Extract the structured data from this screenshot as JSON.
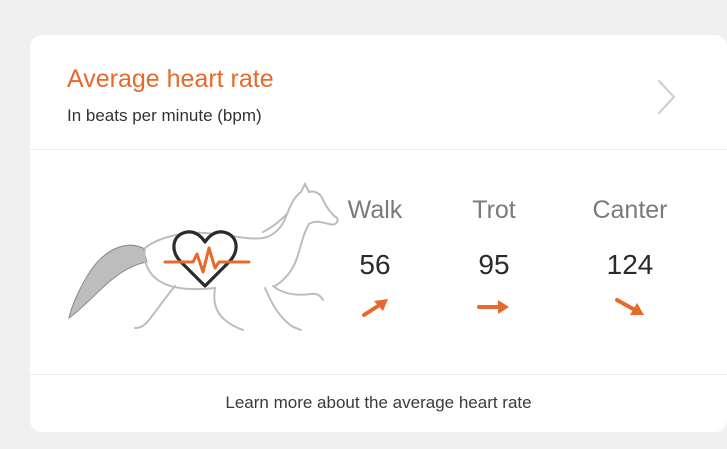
{
  "card": {
    "title": "Average heart rate",
    "subtitle": "In beats per minute (bpm)",
    "chevron_icon": "chevron-right-icon",
    "illustration_icon": "horse-heart-rate-icon"
  },
  "gaits": [
    {
      "label": "Walk",
      "value": "56",
      "trend_icon": "arrow-up-right-icon"
    },
    {
      "label": "Trot",
      "value": "95",
      "trend_icon": "arrow-right-icon"
    },
    {
      "label": "Canter",
      "value": "124",
      "trend_icon": "arrow-down-right-icon"
    }
  ],
  "footer": {
    "link_text": "Learn more about the average heart rate"
  },
  "colors": {
    "accent": "#e8692b",
    "background": "#f0f0f0",
    "card": "#ffffff",
    "label_gray": "#7a7a7a"
  }
}
